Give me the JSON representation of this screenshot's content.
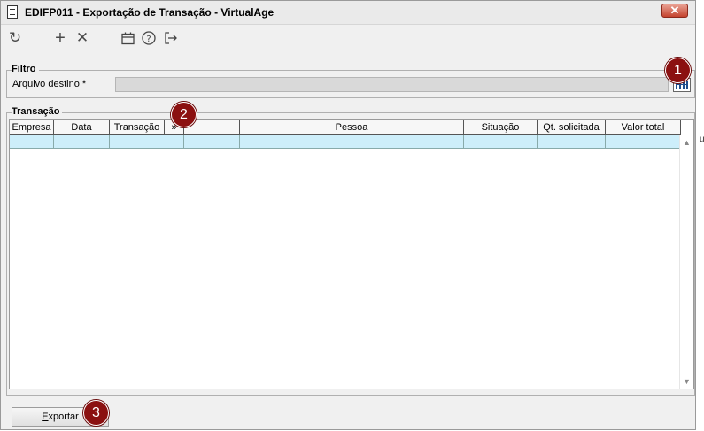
{
  "window": {
    "title": "EDIFP011 - Exportação de Transação - VirtualAge",
    "close_label": "✕"
  },
  "toolbar": {
    "refresh_icon": "↻",
    "add_icon": "+",
    "cancel_icon": "✕",
    "calendar_icon": "calendar",
    "help_icon": "?",
    "exit_icon": "exit"
  },
  "filter": {
    "legend": "Filtro",
    "file_label": "Arquivo destino *",
    "file_value": ""
  },
  "transactions": {
    "legend": "Transação",
    "columns": [
      "Empresa",
      "Data",
      "Transação",
      "»",
      "",
      "Pessoa",
      "Situação",
      "Qt. solicitada",
      "Valor total"
    ]
  },
  "footer": {
    "export_label_u": "E",
    "export_label_rest": "xportar"
  },
  "badges": [
    "1",
    "2",
    "3"
  ],
  "edge_char": "u",
  "colors": {
    "row_highlight": "#cdeefa",
    "badge": "#8b1010"
  }
}
